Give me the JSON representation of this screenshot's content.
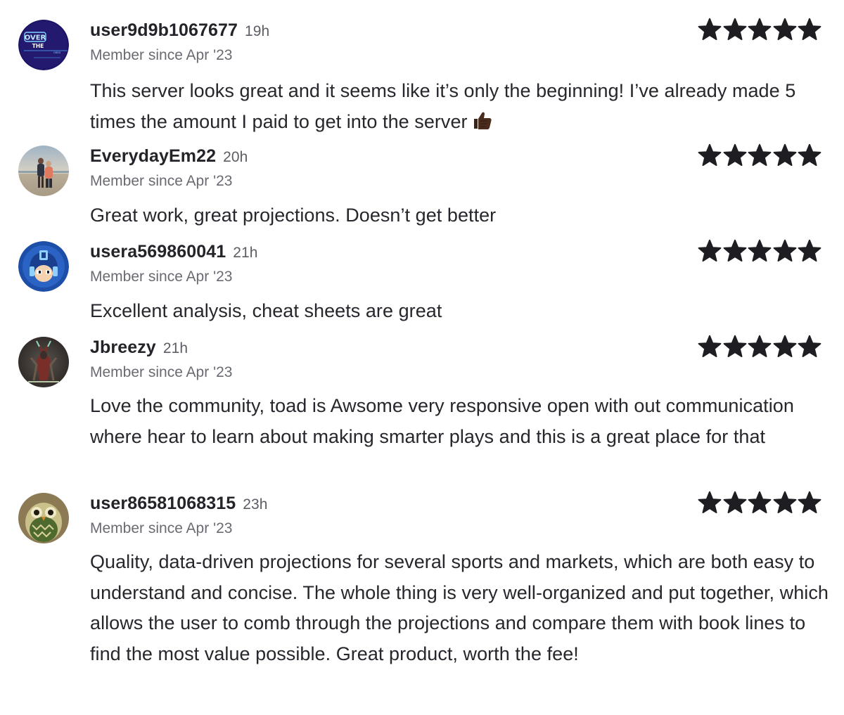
{
  "reviews": [
    {
      "username": "user9d9b1067677",
      "time": "19h",
      "member_since": "Member since Apr '23",
      "rating": 5,
      "text": "This server looks great and it seems like it’s only the beginning! I’ve already made 5 times the amount I paid to get into the server",
      "emoji": "thumbs-up-icon",
      "avatar_text": [
        "OVER",
        "THE",
        "ODDS"
      ]
    },
    {
      "username": "EverydayEm22",
      "time": "20h",
      "member_since": "Member since Apr '23",
      "rating": 5,
      "text": "Great work, great projections. Doesn’t get better"
    },
    {
      "username": "usera569860041",
      "time": "21h",
      "member_since": "Member since Apr '23",
      "rating": 5,
      "text": "Excellent analysis, cheat sheets are great"
    },
    {
      "username": "Jbreezy",
      "time": "21h",
      "member_since": "Member since Apr '23",
      "rating": 5,
      "text": "Love the community, toad is Awsome very responsive open with out communication where hear to learn about making smarter plays and this is a great place for that"
    },
    {
      "username": "user86581068315",
      "time": "23h",
      "member_since": "Member since Apr '23",
      "rating": 5,
      "text": "Quality, data-driven projections for several sports and markets, which are both easy to understand and concise. The whole thing is very well-organized and put together, which allows the user to comb through the projections and compare them with book lines to find the most value possible. Great product, worth the fee!"
    }
  ],
  "colors": {
    "star": "#1d1d22",
    "username": "#23232a",
    "meta": "#6a6a72",
    "body_text": "#26262c"
  }
}
